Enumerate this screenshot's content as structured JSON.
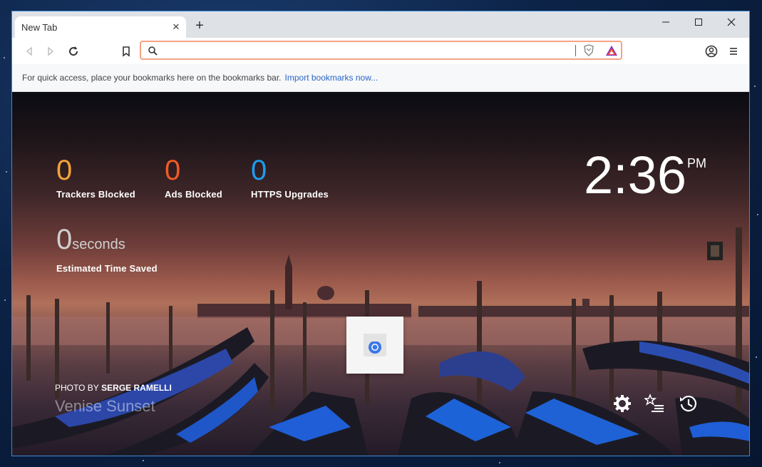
{
  "browser": {
    "tab": {
      "title": "New Tab",
      "close_glyph": "✕"
    },
    "new_tab_glyph": "+",
    "window_controls": {
      "minimize": "—",
      "maximize": "☐",
      "close": "✕"
    },
    "omnibox": {
      "value": "",
      "placeholder": ""
    },
    "bookmarks_bar": {
      "message": "For quick access, place your bookmarks here on the bookmarks bar.",
      "import_link": "Import bookmarks now..."
    }
  },
  "new_tab_page": {
    "stats": {
      "trackers": {
        "value": "0",
        "label": "Trackers Blocked",
        "color": "#f5a23a"
      },
      "ads": {
        "value": "0",
        "label": "Ads Blocked",
        "color": "#f15a24"
      },
      "https": {
        "value": "0",
        "label": "HTTPS Upgrades",
        "color": "#1e9cf0"
      },
      "time_saved": {
        "value": "0",
        "unit": "seconds",
        "label": "Estimated Time Saved",
        "color": "#cfcfcf"
      }
    },
    "clock": {
      "time": "2:36",
      "ampm": "PM"
    },
    "photo_credit": {
      "prefix": "PHOTO BY",
      "author": "SERGE RAMELLI",
      "title": "Venise Sunset"
    },
    "icons": [
      "gear-icon",
      "bookmarks-icon",
      "history-icon"
    ]
  }
}
